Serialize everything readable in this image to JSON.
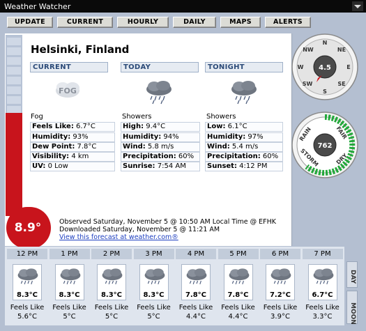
{
  "window": {
    "title": "Weather Watcher"
  },
  "nav": [
    "UPDATE",
    "CURRENT",
    "HOURLY",
    "DAILY",
    "MAPS",
    "ALERTS"
  ],
  "location": "Helsinki, Finland",
  "current": {
    "header": "CURRENT",
    "icon_label": "FOG",
    "condition": "Fog",
    "rows": [
      {
        "label": "Feels Like:",
        "value": "6.7°C"
      },
      {
        "label": "Humidity:",
        "value": "93%"
      },
      {
        "label": "Dew Point:",
        "value": "7.8°C"
      },
      {
        "label": "Visibility:",
        "value": "4 km"
      },
      {
        "label": "UV:",
        "value": "0 Low"
      }
    ]
  },
  "today": {
    "header": "TODAY",
    "condition": "Showers",
    "rows": [
      {
        "label": "High:",
        "value": "9.4°C"
      },
      {
        "label": "Humidity:",
        "value": "94%"
      },
      {
        "label": "Wind:",
        "value": "5.8 m/s"
      },
      {
        "label": "Precipitation:",
        "value": "60%"
      },
      {
        "label": "Sunrise:",
        "value": "7:54 AM"
      }
    ]
  },
  "tonight": {
    "header": "TONIGHT",
    "condition": "Showers",
    "rows": [
      {
        "label": "Low:",
        "value": "6.1°C"
      },
      {
        "label": "Humidity:",
        "value": "97%"
      },
      {
        "label": "Wind:",
        "value": "5.4 m/s"
      },
      {
        "label": "Precipitation:",
        "value": "60%"
      },
      {
        "label": "Sunset:",
        "value": "4:12 PM"
      }
    ]
  },
  "compass": {
    "value": "4.5",
    "labels": {
      "n": "N",
      "ne": "NE",
      "e": "E",
      "se": "SE",
      "s": "S",
      "sw": "SW",
      "w": "W",
      "nw": "NW"
    }
  },
  "barometer": {
    "value": "762",
    "labels": {
      "rain": "RAIN",
      "fair": "FAIR",
      "storm": "STORM",
      "dry": "DRY"
    }
  },
  "thermometer": {
    "value": "8.9°"
  },
  "observed": "Observed Saturday, November 5 @ 10:50 AM Local Time @ EFHK",
  "downloaded": "Downloaded Saturday, November 5 @ 11:21 AM",
  "forecast_link": "View this forecast at weather.com®",
  "hourly": [
    {
      "time": "12 PM",
      "temp": "8.3°C",
      "feels_label": "Feels Like",
      "feels": "5.6°C"
    },
    {
      "time": "1 PM",
      "temp": "8.3°C",
      "feels_label": "Feels Like",
      "feels": "5°C"
    },
    {
      "time": "2 PM",
      "temp": "8.3°C",
      "feels_label": "Feels Like",
      "feels": "5°C"
    },
    {
      "time": "3 PM",
      "temp": "8.3°C",
      "feels_label": "Feels Like",
      "feels": "5°C"
    },
    {
      "time": "4 PM",
      "temp": "7.8°C",
      "feels_label": "Feels Like",
      "feels": "4.4°C"
    },
    {
      "time": "5 PM",
      "temp": "7.8°C",
      "feels_label": "Feels Like",
      "feels": "4.4°C"
    },
    {
      "time": "6 PM",
      "temp": "7.2°C",
      "feels_label": "Feels Like",
      "feels": "3.9°C"
    },
    {
      "time": "7 PM",
      "temp": "6.7°C",
      "feels_label": "Feels Like",
      "feels": "3.3°C"
    }
  ],
  "tabs": {
    "day": "DAY",
    "moon": "MOON"
  },
  "colors": {
    "thermo_red": "#c8141c",
    "header_blue": "#2b4a78",
    "barometer_green": "#22a83a",
    "link": "#1d3fc0"
  }
}
